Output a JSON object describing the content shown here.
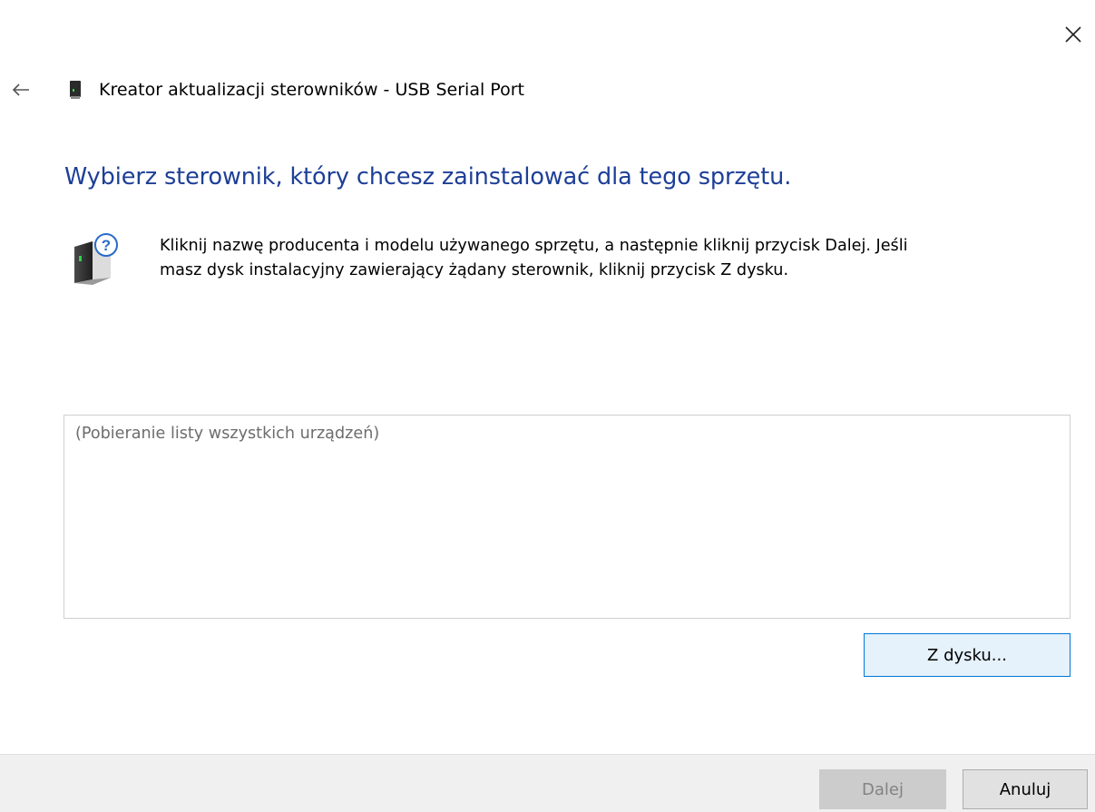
{
  "window": {
    "title": "Kreator aktualizacji sterowników - USB Serial Port",
    "close_icon": "close-icon",
    "back_icon": "back-arrow-icon",
    "device_icon": "usb-device-icon"
  },
  "main": {
    "heading": "Wybierz sterownik, który chcesz zainstalować dla tego sprzętu.",
    "instruction_icon": "device-question-icon",
    "instruction_line1": "Kliknij nazwę producenta i modelu używanego sprzętu, a następnie kliknij przycisk Dalej. Jeśli",
    "instruction_line2": "masz dysk instalacyjny zawierający żądany sterownik, kliknij przycisk Z dysku.",
    "list_placeholder": "(Pobieranie listy wszystkich urządzeń)",
    "have_disk_label": "Z dysku..."
  },
  "footer": {
    "next_label": "Dalej",
    "next_enabled": false,
    "cancel_label": "Anuluj"
  },
  "colors": {
    "heading": "#1e3f97",
    "focus_border": "#0078d7",
    "footer_bg": "#f0f0f0"
  }
}
